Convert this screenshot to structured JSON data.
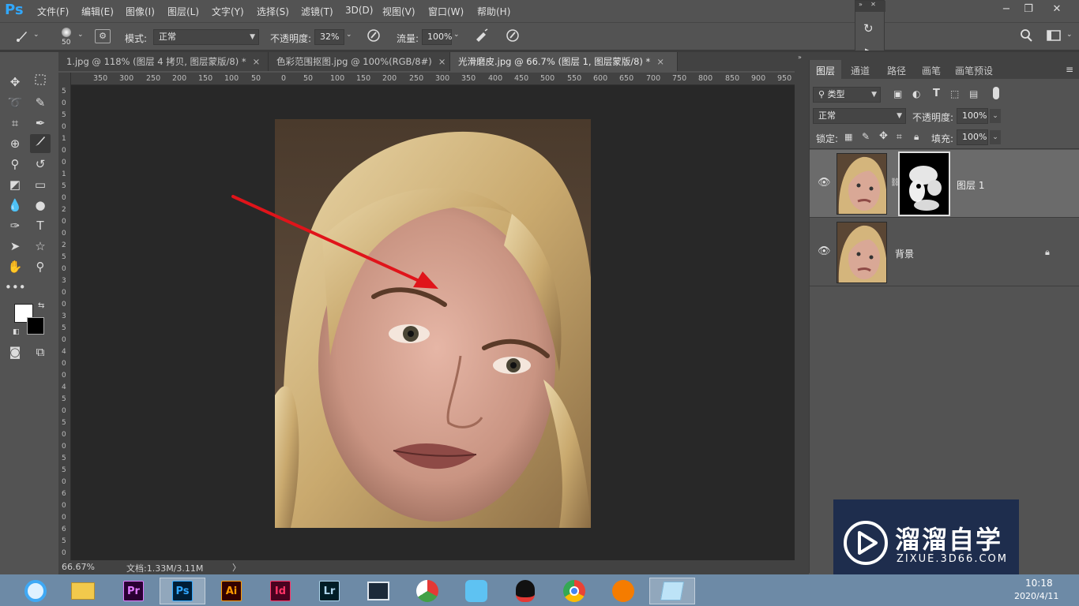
{
  "app": {
    "logo": "Ps"
  },
  "menu": [
    "文件(F)",
    "编辑(E)",
    "图像(I)",
    "图层(L)",
    "文字(Y)",
    "选择(S)",
    "滤镜(T)",
    "3D(D)",
    "视图(V)",
    "窗口(W)",
    "帮助(H)"
  ],
  "window_controls": {
    "minimize": "−",
    "restore": "❐",
    "close": "✕"
  },
  "options": {
    "brush_size": "50",
    "mode_label": "模式:",
    "mode_value": "正常",
    "opacity_label": "不透明度:",
    "opacity_value": "32%",
    "flow_label": "流量:",
    "flow_value": "100%"
  },
  "tabs": [
    {
      "label": "1.jpg @ 118% (图层 4 拷贝, 图层蒙版/8) *",
      "close": "×"
    },
    {
      "label": "色彩范围抠图.jpg @ 100%(RGB/8#)",
      "close": "×"
    },
    {
      "label": "光滑磨皮.jpg @ 66.7% (图层 1, 图层蒙版/8) *",
      "close": "×"
    }
  ],
  "ruler_top": [
    "350",
    "300",
    "250",
    "200",
    "150",
    "100",
    "50",
    "0",
    "50",
    "100",
    "150",
    "200",
    "250",
    "300",
    "350",
    "400",
    "450",
    "500",
    "550",
    "600",
    "650",
    "700",
    "750",
    "800",
    "850",
    "900",
    "950"
  ],
  "ruler_left": [
    "5",
    "0",
    "5",
    "0",
    "1",
    "0",
    "0",
    "1",
    "5",
    "0",
    "2",
    "0",
    "0",
    "2",
    "5",
    "0",
    "3",
    "0",
    "0",
    "3",
    "5",
    "0",
    "4",
    "0",
    "0",
    "4",
    "5",
    "0",
    "5",
    "0",
    "0",
    "5",
    "5",
    "0",
    "6",
    "0",
    "0",
    "6",
    "5",
    "0"
  ],
  "status": {
    "zoom": "66.67%",
    "doc": "文档:1.33M/3.11M",
    "arrow": "〉"
  },
  "panel": {
    "tabs": [
      "图层",
      "通道",
      "路径",
      "画笔",
      "画笔预设"
    ],
    "filter_kind": "类型",
    "blend_mode": "正常",
    "opacity_label": "不透明度:",
    "opacity_value": "100%",
    "lock_label": "锁定:",
    "fill_label": "填充:",
    "fill_value": "100%",
    "layers": [
      {
        "name": "图层 1",
        "visible": true,
        "has_mask": true
      },
      {
        "name": "背景",
        "visible": true,
        "locked": true
      }
    ]
  },
  "taskbar": {
    "apps": [
      "ie",
      "explorer",
      "Pr",
      "Ps",
      "Ai",
      "Id",
      "Lr",
      "video",
      "app-green",
      "app-bird",
      "qq",
      "chrome",
      "app-orange",
      "notes"
    ],
    "time": "10:18",
    "date": "2020/4/11"
  },
  "watermark": {
    "title": "溜溜自学",
    "url": "ZIXUE.3D66.COM"
  },
  "colors": {
    "ps_blue": "#31a8ff",
    "pr": "#2a0033",
    "ai": "#330000",
    "id": "#49021f",
    "lr": "#001d26",
    "arrow": "#e0141a"
  }
}
